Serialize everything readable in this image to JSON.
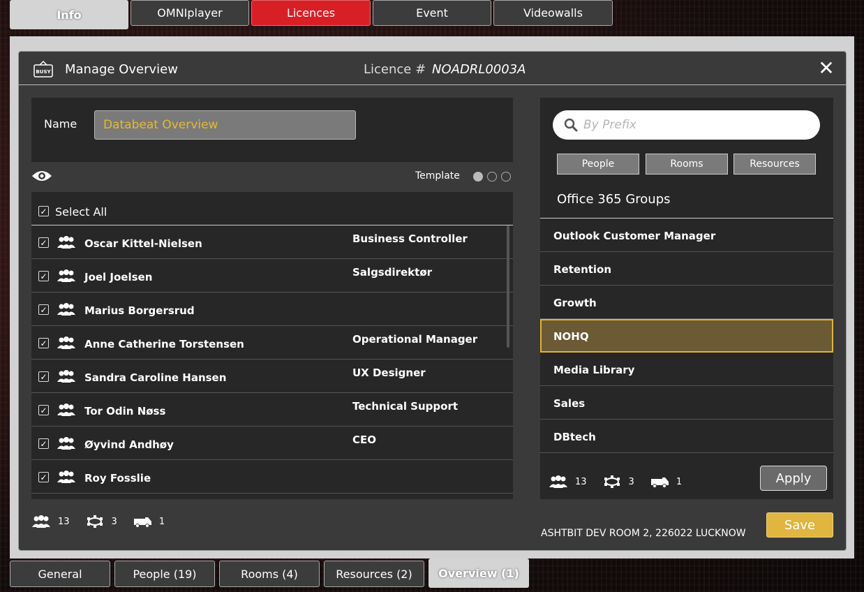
{
  "top_tabs": [
    {
      "label": "Info",
      "active": true
    },
    {
      "label": "OMNIplayer"
    },
    {
      "label": "Licences"
    },
    {
      "label": "Event"
    },
    {
      "label": "Videowalls"
    }
  ],
  "header": {
    "busy_icon_text": "BUSY",
    "title": "Manage Overview",
    "licence_label": "Licence #",
    "licence_value": "NOADRL0003A"
  },
  "name_field": {
    "label": "Name",
    "value": "Databeat Overview"
  },
  "template": {
    "label": "Template",
    "selected_index": 0,
    "count": 3
  },
  "people_list": {
    "select_all_label": "Select All",
    "rows": [
      {
        "name": "Oscar Kittel-Nielsen",
        "role": "Business Controller"
      },
      {
        "name": "Joel Joelsen",
        "role": "Salgsdirektør"
      },
      {
        "name": "Marius Borgersrud",
        "role": ""
      },
      {
        "name": "Anne Catherine Torstensen",
        "role": "Operational Manager"
      },
      {
        "name": "Sandra Caroline Hansen",
        "role": "UX Designer"
      },
      {
        "name": "Tor Odin Nøss",
        "role": "Technical Support"
      },
      {
        "name": "Øyvind Andhøy",
        "role": "CEO"
      },
      {
        "name": "Roy Fosslie",
        "role": ""
      }
    ]
  },
  "left_stats": {
    "people": "13",
    "rooms": "3",
    "resources": "1"
  },
  "search": {
    "placeholder": "By Prefix"
  },
  "filters": {
    "people": "People",
    "rooms": "Rooms",
    "resources": "Resources"
  },
  "groups": {
    "title": "Office 365 Groups",
    "items": [
      "Outlook Customer Manager",
      "Retention",
      "Growth",
      "NOHQ",
      "Media Library",
      "Sales",
      "DBtech"
    ],
    "selected": "NOHQ"
  },
  "right_stats": {
    "people": "13",
    "rooms": "3",
    "resources": "1"
  },
  "apply_label": "Apply",
  "address": "ASHTBIT DEV ROOM 2, 226022 LUCKNOW",
  "save_label": "Save",
  "bottom_tabs": [
    {
      "label": "General"
    },
    {
      "label": "People (19)"
    },
    {
      "label": "Rooms (4)"
    },
    {
      "label": "Resources (2)"
    },
    {
      "label": "Overview (1)",
      "active": true
    }
  ],
  "colors": {
    "accent": "#e0b540",
    "danger": "#d91f26",
    "selected_bg": "#6b5a34"
  }
}
